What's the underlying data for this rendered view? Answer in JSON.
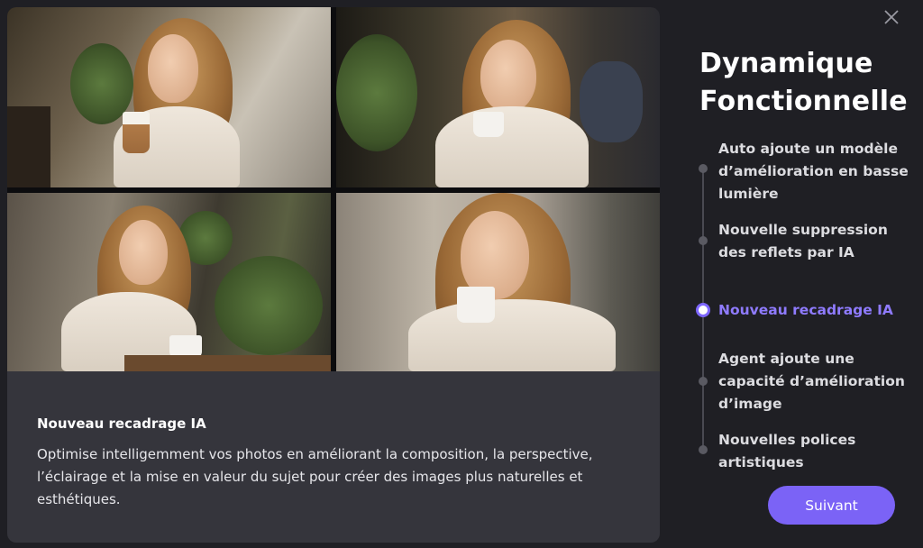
{
  "sidebar": {
    "title_line1": "Dynamique",
    "title_line2": "Fonctionnelle",
    "items": [
      {
        "label": "Auto ajoute un modèle d’amélioration en basse lumière",
        "active": false
      },
      {
        "label": "Nouvelle suppression des reflets par IA",
        "active": false
      },
      {
        "label": "Nouveau recadrage IA",
        "active": true
      },
      {
        "label": "Agent ajoute une capacité d’amélioration d’image",
        "active": false
      },
      {
        "label": "Nouvelles polices artistiques",
        "active": false
      }
    ],
    "next_label": "Suivant"
  },
  "caption": {
    "title": "Nouveau recadrage IA",
    "body": "Optimise intelligemment vos photos en améliorant la composition, la perspective, l’éclairage et la mise en valeur du sujet pour créer des images plus naturelles et esthétiques."
  },
  "icons": {
    "close": "close-icon"
  },
  "colors": {
    "accent": "#7b63f6",
    "active_text": "#8f7bff",
    "background": "#1f1f24",
    "panel": "#35353c"
  }
}
